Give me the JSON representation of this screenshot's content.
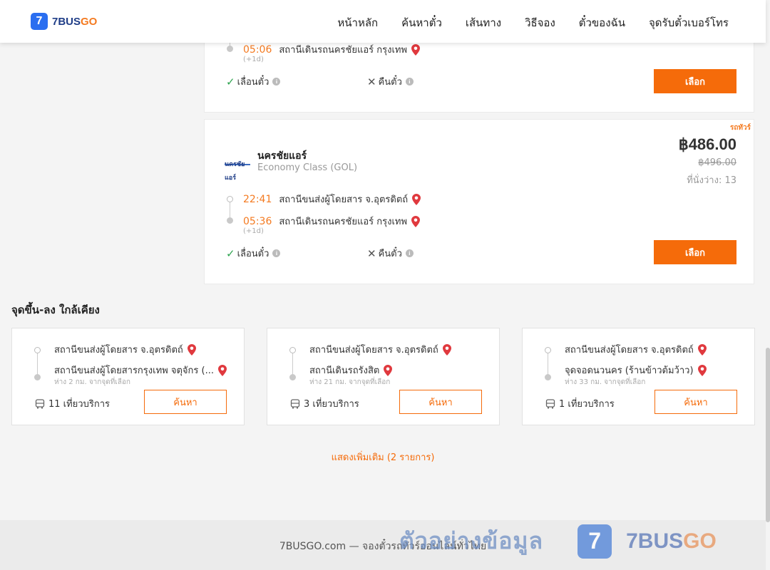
{
  "header": {
    "logo_mark": "7",
    "logo_text_a": "7BUS",
    "logo_text_b": "GO",
    "nav": [
      "หน้าหลัก",
      "ค้นหาตั๋ว",
      "เส้นทาง",
      "วิธีจอง",
      "ตั๋วของฉัน",
      "จุดรับตั๋วเบอร์โทร"
    ]
  },
  "trip1": {
    "arrival_time": "05:06",
    "arrival_station": "สถานีเดินรถนครชัยแอร์ กรุงเทพ",
    "next_day": "(+1d)",
    "reschedule": "เลื่อนตั๋ว",
    "refund": "คืนตั๋ว",
    "select_label": "เลือก"
  },
  "trip2": {
    "tag": "รถทัวร์",
    "operator_logo_text": "นครชัยแอร์",
    "operator_name": "นครชัยแอร์",
    "bus_class": "Economy Class (GOL)",
    "price": "฿486.00",
    "old_price": "฿496.00",
    "seats": "ที่นั่งว่าง: 13",
    "departure_time": "22:41",
    "departure_station": "สถานีขนส่งผู้โดยสาร จ.อุตรดิตถ์",
    "arrival_time": "05:36",
    "arrival_station": "สถานีเดินรถนครชัยแอร์ กรุงเทพ",
    "next_day": "(+1d)",
    "reschedule": "เลื่อนตั๋ว",
    "refund": "คืนตั๋ว",
    "select_label": "เลือก"
  },
  "nearby": {
    "title": "จุดขึ้น-ลง ใกล้เคียง",
    "cards": [
      {
        "from": "สถานีขนส่งผู้โดยสาร จ.อุตรดิตถ์",
        "to": "สถานีขนส่งผู้โดยสารกรุงเทพ จตุจักร (...",
        "distance": "ห่าง 2 กม. จากจุดที่เลือก",
        "trips": "11 เที่ยวบริการ",
        "button": "ค้นหา"
      },
      {
        "from": "สถานีขนส่งผู้โดยสาร จ.อุตรดิตถ์",
        "to": "สถานีเดินรถรังสิต",
        "distance": "ห่าง 21 กม. จากจุดที่เลือก",
        "trips": "3 เที่ยวบริการ",
        "button": "ค้นหา"
      },
      {
        "from": "สถานีขนส่งผู้โดยสาร จ.อุตรดิตถ์",
        "to": "จุดจอดนวนคร (ร้านข้าวต้มว้าว)",
        "distance": "ห่าง 33 กม. จากจุดที่เลือก",
        "trips": "1 เที่ยวบริการ",
        "button": "ค้นหา"
      }
    ],
    "show_more": "แสดงเพิ่มเติม (2 รายการ)"
  },
  "footer": {
    "text": "7BUSGO.com — จองตั๋วรถทัวร์ออนไลน์ทั่วไทย"
  },
  "watermark": {
    "text": "ตัวอย่างข้อมูล",
    "logo_mark": "7",
    "brand_a": "7BUS",
    "brand_b": "GO"
  },
  "colors": {
    "accent": "#f56b0a",
    "time": "#f47a20",
    "brand_blue": "#1f3d87",
    "check": "#2ea44f"
  }
}
